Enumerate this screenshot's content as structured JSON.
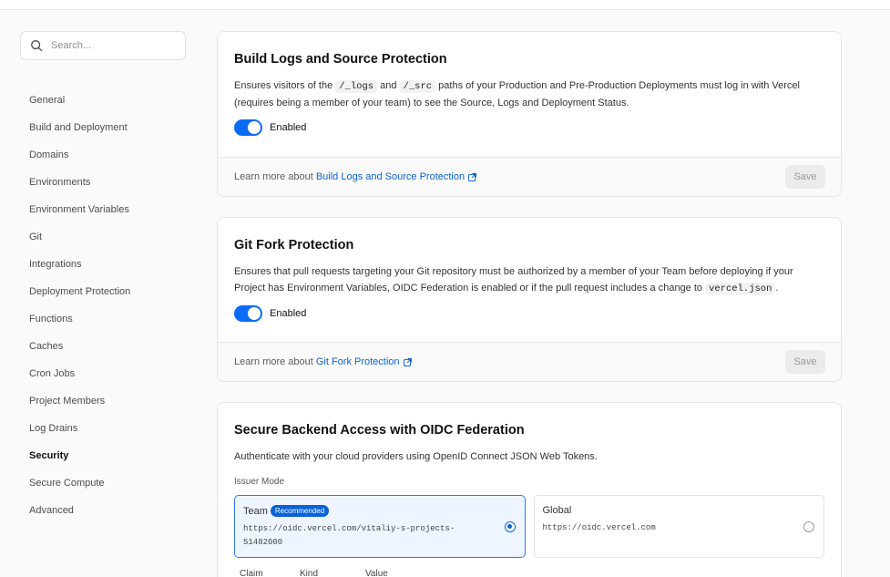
{
  "search": {
    "placeholder": "Search..."
  },
  "sidebar": {
    "items": [
      {
        "label": "General"
      },
      {
        "label": "Build and Deployment"
      },
      {
        "label": "Domains"
      },
      {
        "label": "Environments"
      },
      {
        "label": "Environment Variables"
      },
      {
        "label": "Git"
      },
      {
        "label": "Integrations"
      },
      {
        "label": "Deployment Protection"
      },
      {
        "label": "Functions"
      },
      {
        "label": "Caches"
      },
      {
        "label": "Cron Jobs"
      },
      {
        "label": "Project Members"
      },
      {
        "label": "Log Drains"
      },
      {
        "label": "Security"
      },
      {
        "label": "Secure Compute"
      },
      {
        "label": "Advanced"
      }
    ],
    "active": "Security"
  },
  "build_logs": {
    "title": "Build Logs and Source Protection",
    "desc_1": "Ensures visitors of the",
    "code_1": "/_logs",
    "desc_2": "and",
    "code_2": "/_src",
    "desc_3": "paths of your Production and Pre-Production Deployments must log in with Vercel (requires being a member of your team) to see the Source, Logs and Deployment Status.",
    "toggle_label": "Enabled",
    "toggle_on": true,
    "footer_prefix": "Learn more about",
    "footer_link": "Build Logs and Source Protection",
    "save_label": "Save"
  },
  "git_fork": {
    "title": "Git Fork Protection",
    "desc_1": "Ensures that pull requests targeting your Git repository must be authorized by a member of your Team before deploying if your Project has Environment Variables, OIDC Federation is enabled or if the pull request includes a change to",
    "code_1": "vercel.json",
    "desc_2": ".",
    "toggle_label": "Enabled",
    "toggle_on": true,
    "footer_prefix": "Learn more about",
    "footer_link": "Git Fork Protection",
    "save_label": "Save"
  },
  "oidc": {
    "title": "Secure Backend Access with OIDC Federation",
    "desc": "Authenticate with your cloud providers using OpenID Connect JSON Web Tokens.",
    "issuer_label": "Issuer Mode",
    "options": [
      {
        "label": "Team",
        "badge": "Recommended",
        "url": "https://oidc.vercel.com/vitaliy-s-projects-51482000",
        "selected": true
      },
      {
        "label": "Global",
        "url": "https://oidc.vercel.com",
        "selected": false
      }
    ],
    "table_headers": [
      "Claim",
      "Kind",
      "Value"
    ]
  },
  "colors": {
    "accent": "#0a6cf5",
    "link": "#0a62d6"
  }
}
